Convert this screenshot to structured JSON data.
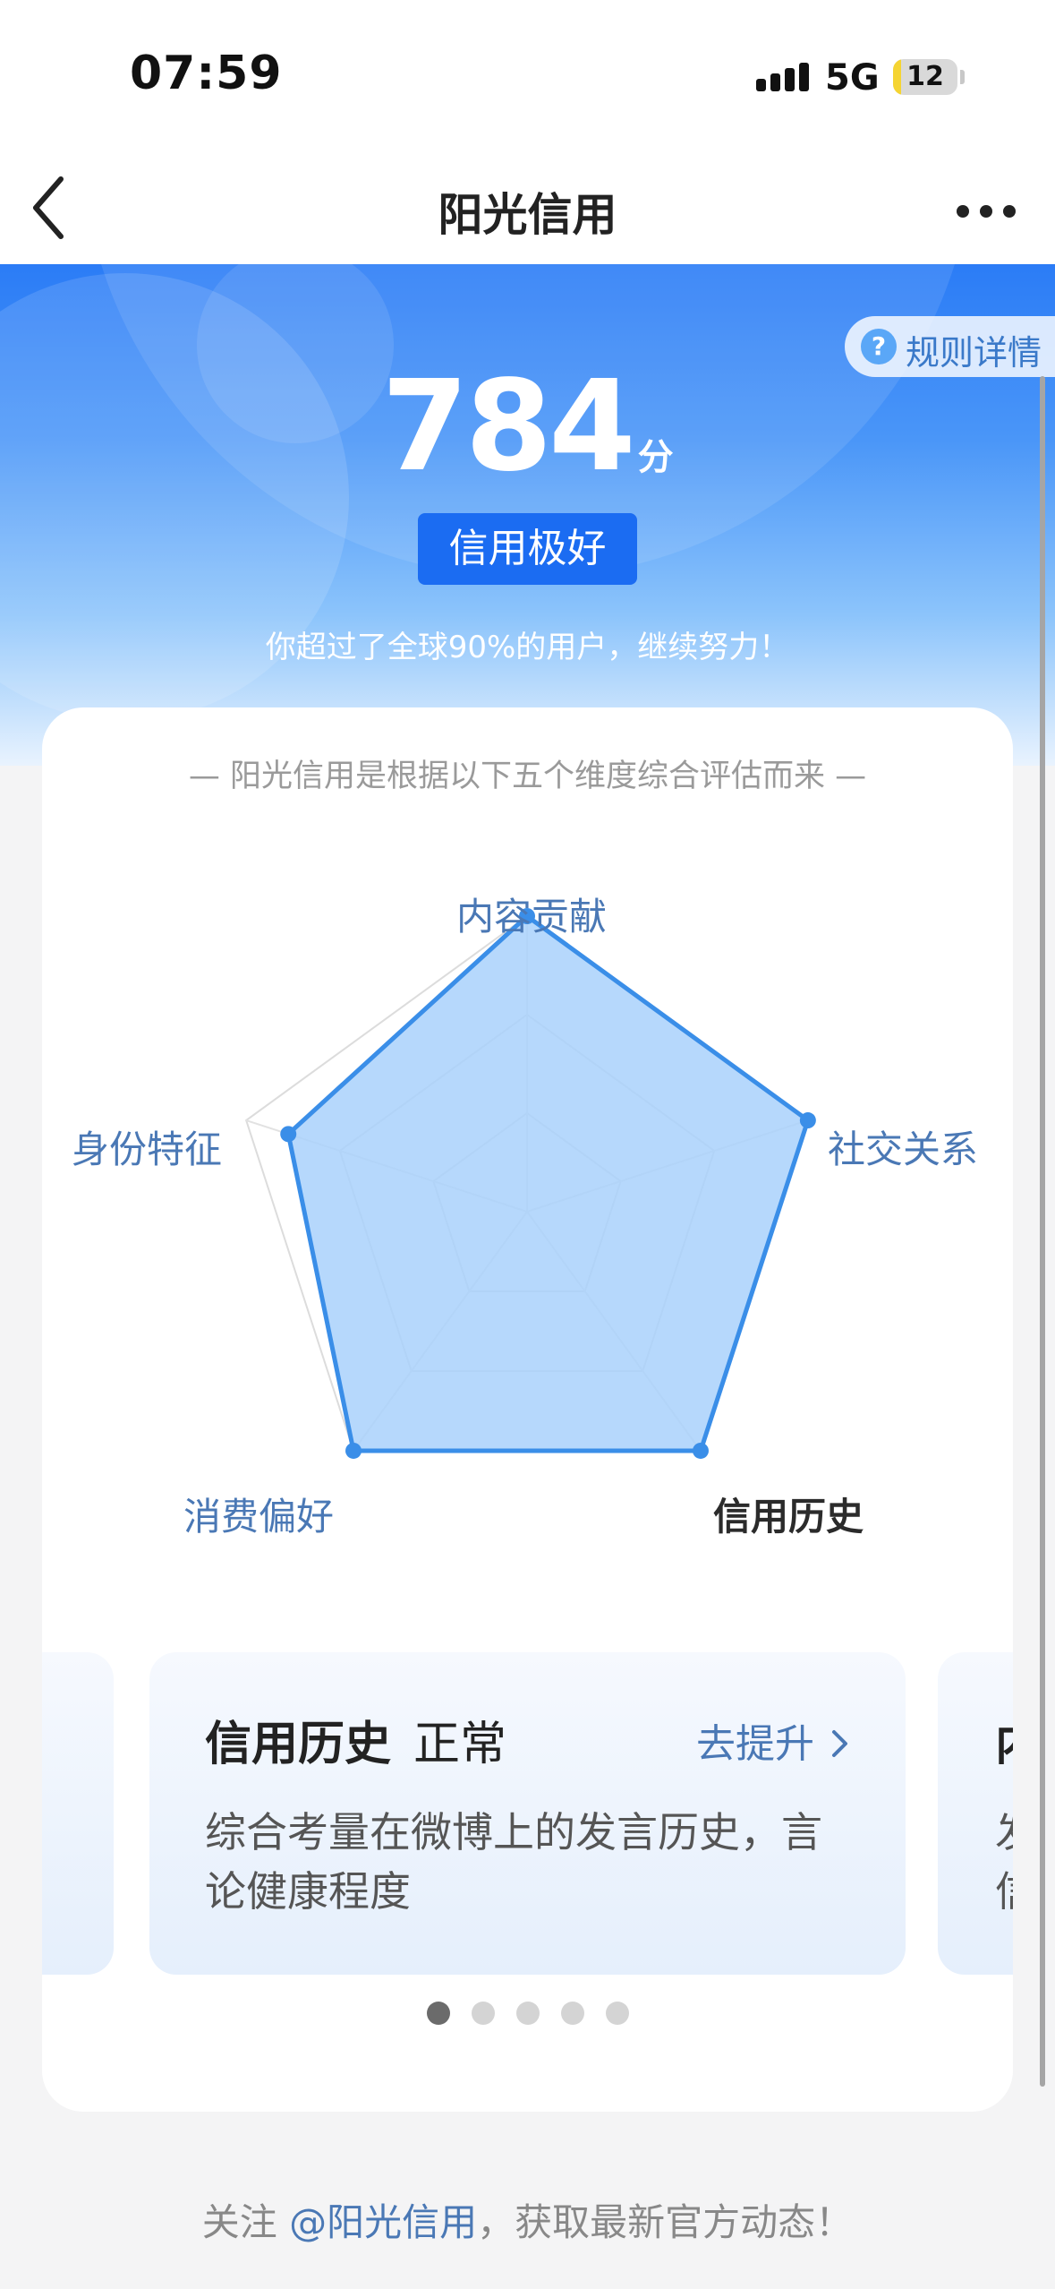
{
  "status": {
    "time": "07:59",
    "network": "5G",
    "battery": "12",
    "battery_level": 0.12
  },
  "nav": {
    "title": "阳光信用",
    "back_icon": "chevron-left-icon",
    "more_icon": "more-dots-icon"
  },
  "hero": {
    "rules_label": "规则详情",
    "rules_icon": "?",
    "score": "784",
    "score_unit": "分",
    "level": "信用极好",
    "beat_text": "你超过了全球90%的用户，继续努力！"
  },
  "card": {
    "subtitle": "— 阳光信用是根据以下五个维度综合评估而来 —",
    "dimensions": [
      {
        "label": "内容贡献",
        "value": 1.0
      },
      {
        "label": "社交关系",
        "value": 1.0
      },
      {
        "label": "信用历史",
        "value": 1.0
      },
      {
        "label": "消费偏好",
        "value": 1.0
      },
      {
        "label": "身份特征",
        "value": 0.85
      }
    ],
    "active_dimension": "信用历史",
    "slide": {
      "title": "信用历史",
      "status": "正常",
      "link": "去提升",
      "link_icon": "chevron-right-icon",
      "description": "综合考量在微博上的发言历史，言论健康程度"
    },
    "next_peek": {
      "title": "内",
      "desc_line1": "发",
      "desc_line2": "信"
    },
    "pager": {
      "count": 5,
      "active": 0
    }
  },
  "footer": {
    "prefix": "关注 ",
    "handle": "@阳光信用",
    "suffix": "，获取最新官方动态！"
  },
  "colors": {
    "primary": "#1b6cf2",
    "radar_stroke": "#3a8ee8",
    "radar_fill": "#a9d1fb",
    "label_blue": "#4a78b5"
  }
}
